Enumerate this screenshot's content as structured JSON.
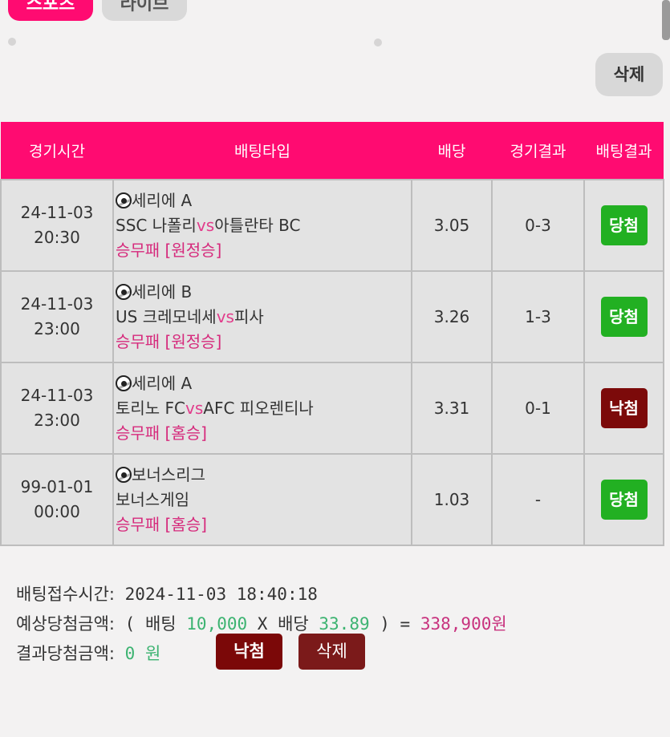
{
  "tabs": {
    "active_label": "스포츠",
    "inactive_label": "라이브"
  },
  "toolbar": {
    "delete_label": "삭제"
  },
  "table": {
    "headers": [
      "경기시간",
      "배팅타입",
      "배당",
      "경기결과",
      "배팅결과"
    ],
    "rows": [
      {
        "date": "24-11-03",
        "time": "20:30",
        "league": "세리에 A",
        "home": "SSC 나폴리",
        "vs": "vs",
        "away": "아틀란타 BC",
        "market": "승무패 [원정승]",
        "odds": "3.05",
        "score": "0-3",
        "result": "당첨"
      },
      {
        "date": "24-11-03",
        "time": "23:00",
        "league": "세리에 B",
        "home": "US 크레모네세",
        "vs": "vs",
        "away": "피사",
        "market": "승무패 [원정승]",
        "odds": "3.26",
        "score": "1-3",
        "result": "당첨"
      },
      {
        "date": "24-11-03",
        "time": "23:00",
        "league": "세리에 A",
        "home": "토리노 FC",
        "vs": "vs",
        "away": "AFC 피오렌티나",
        "market": "승무패 [홈승]",
        "odds": "3.31",
        "score": "0-1",
        "result": "낙첨"
      },
      {
        "date": "99-01-01",
        "time": "00:00",
        "league": "보너스리그",
        "home": "보너스게임",
        "vs": "",
        "away": "",
        "market": "승무패 [홈승]",
        "odds": "1.03",
        "score": "-",
        "result": "당첨"
      }
    ]
  },
  "summary": {
    "bet_time_label": "배팅접수시간:",
    "bet_time": "2024-11-03 18:40:18",
    "expected_label": "예상당첨금액:",
    "open_paren": "(",
    "bet_word": "배팅",
    "bet_amount": "10,000",
    "times": "X",
    "odds_word": "배당",
    "total_odds": "33.89",
    "close_eq": ") =",
    "expected_amount": "338,900원",
    "result_label": "결과당첨금액:",
    "result_amount": "0 원"
  },
  "actions": {
    "status_label": "낙첨",
    "delete_label": "삭제"
  },
  "colors": {
    "accent": "#ff0b71",
    "win": "#22b022",
    "lose": "#7c0a0a"
  }
}
